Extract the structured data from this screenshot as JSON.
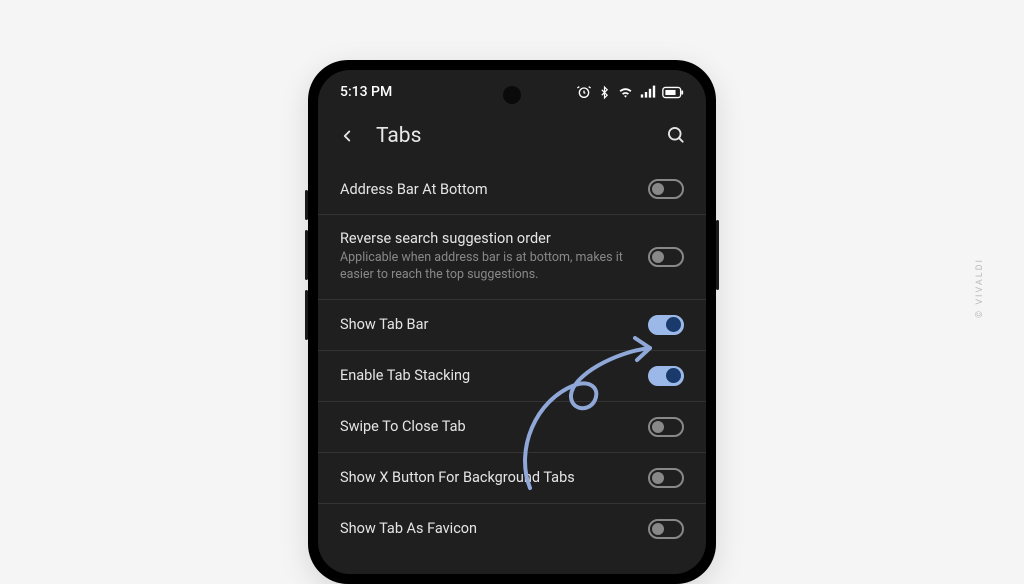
{
  "status": {
    "time": "5:13 PM"
  },
  "header": {
    "title": "Tabs"
  },
  "settings": [
    {
      "label": "Address Bar At Bottom",
      "desc": "",
      "on": false
    },
    {
      "label": "Reverse search suggestion order",
      "desc": "Applicable when address bar is at bottom, makes it easier to reach the top suggestions.",
      "on": false
    },
    {
      "label": "Show Tab Bar",
      "desc": "",
      "on": true
    },
    {
      "label": "Enable Tab Stacking",
      "desc": "",
      "on": true
    },
    {
      "label": "Swipe To Close Tab",
      "desc": "",
      "on": false
    },
    {
      "label": "Show X Button For Background Tabs",
      "desc": "",
      "on": false
    },
    {
      "label": "Show Tab As Favicon",
      "desc": "",
      "on": false
    }
  ],
  "watermark": "© VIVALDI",
  "colors": {
    "toggle_on_bg": "#9bb8e8",
    "toggle_on_knob": "#1a3a6b",
    "arrow": "#8fa8d8"
  }
}
